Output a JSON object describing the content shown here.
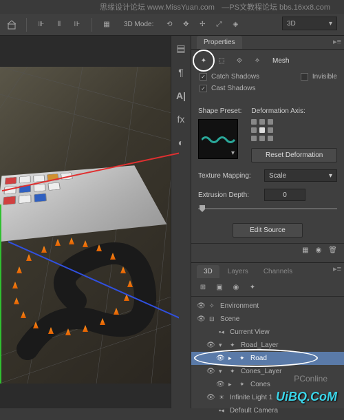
{
  "watermarks": {
    "top_left": "思缘设计论坛  www.MissYuan.com",
    "top_right": "—PS文教程论坛  bbs.16xx8.com",
    "bottom_right": "UiBQ.CoM",
    "pc_online": "PConline"
  },
  "toolbar": {
    "mode_label": "3D Mode:",
    "dropdown_value": "3D"
  },
  "properties": {
    "tab": "Properties",
    "mesh_label": "Mesh",
    "catch_shadows": "Catch Shadows",
    "cast_shadows": "Cast Shadows",
    "invisible": "Invisible",
    "shape_preset": "Shape Preset:",
    "deformation_axis": "Deformation Axis:",
    "reset_deformation": "Reset Deformation",
    "texture_mapping": "Texture Mapping:",
    "texture_mapping_value": "Scale",
    "extrusion_depth": "Extrusion Depth:",
    "extrusion_value": "0",
    "edit_source": "Edit Source"
  },
  "panel3d": {
    "tabs": [
      "3D",
      "Layers",
      "Channels"
    ],
    "items": {
      "environment": "Environment",
      "scene": "Scene",
      "current_view": "Current View",
      "road_layer": "Road_Layer",
      "road": "Road",
      "cones_layer": "Cones_Layer",
      "cones": "Cones",
      "infinite_light": "Infinite Light 1",
      "default_camera": "Default Camera"
    }
  }
}
